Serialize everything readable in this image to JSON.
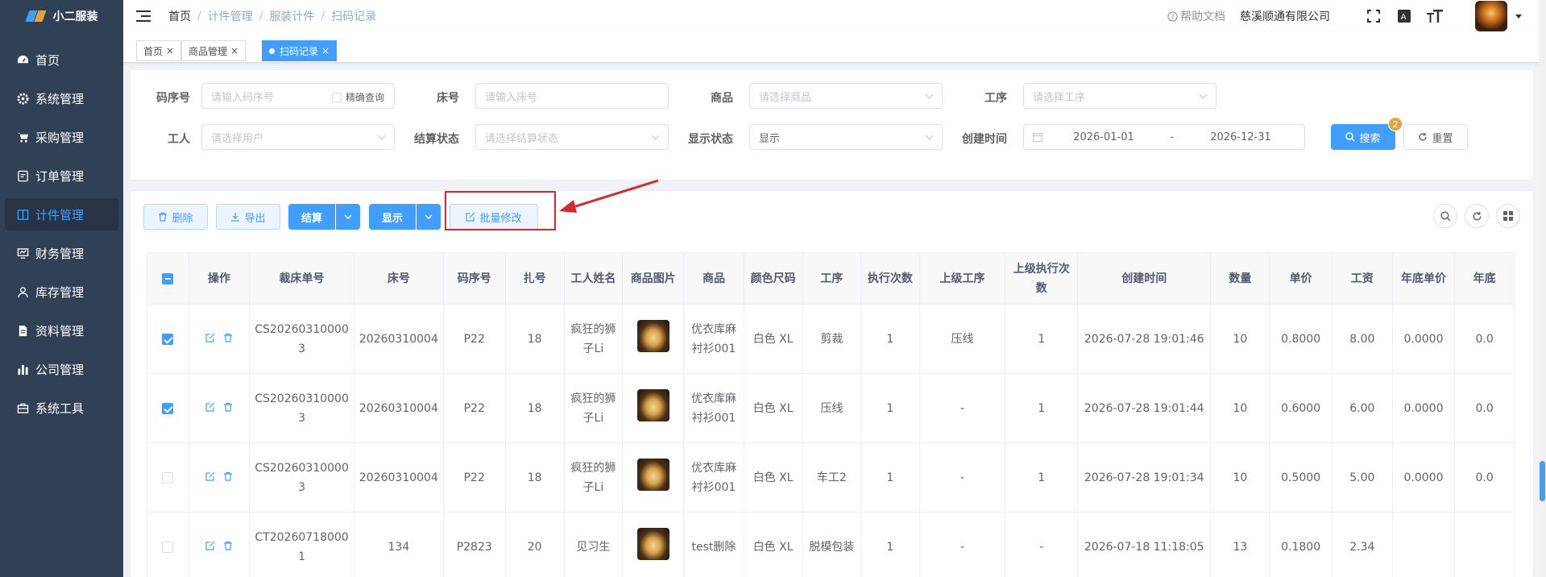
{
  "app": {
    "name": "小二服装"
  },
  "sidebar": {
    "items": [
      {
        "label": "首页",
        "icon": "dashboard-icon"
      },
      {
        "label": "系统管理",
        "icon": "gear-icon"
      },
      {
        "label": "采购管理",
        "icon": "cart-icon"
      },
      {
        "label": "订单管理",
        "icon": "order-icon"
      },
      {
        "label": "计件管理",
        "icon": "book-icon",
        "active": true
      },
      {
        "label": "财务管理",
        "icon": "chart-monitor-icon"
      },
      {
        "label": "库存管理",
        "icon": "user-icon"
      },
      {
        "label": "资料管理",
        "icon": "document-icon"
      },
      {
        "label": "公司管理",
        "icon": "bar-chart-icon"
      },
      {
        "label": "系统工具",
        "icon": "toolbox-icon"
      }
    ]
  },
  "header": {
    "breadcrumb": [
      "首页",
      "计件管理",
      "服装计件",
      "扫码记录"
    ],
    "help": "帮助文档",
    "company": "慈溪顺通有限公司"
  },
  "tags": [
    {
      "label": "首页"
    },
    {
      "label": "商品管理"
    },
    {
      "label": "扫码记录",
      "active": true
    }
  ],
  "search": {
    "code_label": "码序号",
    "code_placeholder": "请输入码序号",
    "exact_label": "精确查询",
    "bed_label": "床号",
    "bed_placeholder": "请输入床号",
    "product_label": "商品",
    "product_placeholder": "请选择商品",
    "process_label": "工序",
    "process_placeholder": "请选择工序",
    "worker_label": "工人",
    "worker_placeholder": "请选择用户",
    "settle_label": "结算状态",
    "settle_placeholder": "请选择结算状态",
    "display_label": "显示状态",
    "display_value": "显示",
    "created_label": "创建时间",
    "date_start": "2026-01-01",
    "date_sep": "-",
    "date_end": "2026-12-31",
    "search_btn": "搜索",
    "search_badge": "2",
    "reset_btn": "重置"
  },
  "toolbar": {
    "delete": "删除",
    "export": "导出",
    "settle": "结算",
    "display": "显示",
    "batch_edit": "批量修改"
  },
  "table": {
    "headers": [
      "操作",
      "裁床单号",
      "床号",
      "码序号",
      "扎号",
      "工人姓名",
      "商品图片",
      "商品",
      "颜色尺码",
      "工序",
      "执行次数",
      "上级工序",
      "上级执行次数",
      "创建时间",
      "数量",
      "单价",
      "工资",
      "年底单价",
      "年底"
    ],
    "rows": [
      {
        "checked": true,
        "cut": "CS20260310000 3",
        "bed": "20260310004",
        "code": "P22",
        "bundle": "18",
        "worker": "疯狂的狮子Li",
        "product": "优衣库麻衬衫001",
        "color": "白色 XL",
        "process": "剪裁",
        "times": "1",
        "parent": "压线",
        "parent_times": "1",
        "created": "2026-07-28 19:01:46",
        "qty": "10",
        "price": "0.8000",
        "wage": "8.00",
        "ye_price": "0.0000",
        "ye": "0.0"
      },
      {
        "checked": true,
        "cut": "CS20260310000 3",
        "bed": "20260310004",
        "code": "P22",
        "bundle": "18",
        "worker": "疯狂的狮子Li",
        "product": "优衣库麻衬衫001",
        "color": "白色 XL",
        "process": "压线",
        "times": "1",
        "parent": "-",
        "parent_times": "1",
        "created": "2026-07-28 19:01:44",
        "qty": "10",
        "price": "0.6000",
        "wage": "6.00",
        "ye_price": "0.0000",
        "ye": "0.0"
      },
      {
        "checked": false,
        "cut": "CS20260310000 3",
        "bed": "20260310004",
        "code": "P22",
        "bundle": "18",
        "worker": "疯狂的狮子Li",
        "product": "优衣库麻衬衫001",
        "color": "白色 XL",
        "process": "车工2",
        "times": "1",
        "parent": "-",
        "parent_times": "1",
        "created": "2026-07-28 19:01:34",
        "qty": "10",
        "price": "0.5000",
        "wage": "5.00",
        "ye_price": "0.0000",
        "ye": "0.0"
      },
      {
        "checked": false,
        "cut": "CT20260718000 1",
        "bed": "134",
        "code": "P2823",
        "bundle": "20",
        "worker": "见习生",
        "product": "test删除",
        "color": "白色 XL",
        "process": "脱模包装",
        "times": "1",
        "parent": "-",
        "parent_times": "-",
        "created": "2026-07-18 11:18:05",
        "qty": "13",
        "price": "0.1800",
        "wage": "2.34",
        "ye_price": "",
        "ye": ""
      }
    ]
  }
}
